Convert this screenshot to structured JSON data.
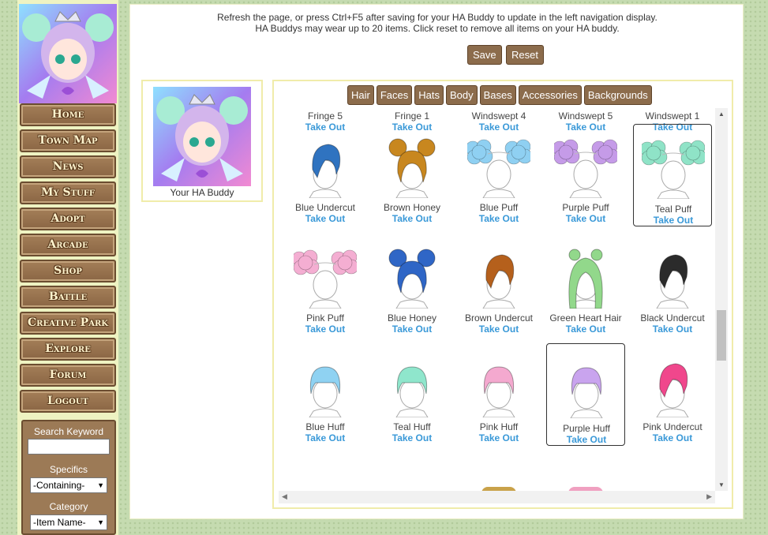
{
  "nav": [
    "Home",
    "Town Map",
    "News",
    "My Stuff",
    "Adopt",
    "Arcade",
    "Shop",
    "Battle",
    "Creative Park",
    "Explore",
    "Forum",
    "Logout"
  ],
  "search": {
    "keyword_label": "Search Keyword",
    "keyword_value": "",
    "specifics_label": "Specifics",
    "specifics_value": "-Containing-",
    "category_label": "Category",
    "category_value": "-Item Name-"
  },
  "info": {
    "line1": "Refresh the page, or press Ctrl+F5 after saving for your HA Buddy to update in the left navigation display.",
    "line2": "HA Buddys may wear up to 20 items. Click reset to remove all items on your HA buddy."
  },
  "actions": {
    "save": "Save",
    "reset": "Reset"
  },
  "buddy_label": "Your HA Buddy",
  "tabs": [
    "Hair",
    "Faces",
    "Hats",
    "Body",
    "Bases",
    "Accessories",
    "Backgrounds"
  ],
  "take_out_label": "Take Out",
  "items_top": [
    "Fringe 5",
    "Fringe 1",
    "Windswept 4",
    "Windswept 5",
    "Windswept 1"
  ],
  "items": [
    {
      "name": "Blue Undercut",
      "style": "undercut",
      "color": "#2f73c0",
      "selected": false
    },
    {
      "name": "Brown Honey",
      "style": "buns",
      "color": "#c8871f",
      "selected": false
    },
    {
      "name": "Blue Puff",
      "style": "puff",
      "color": "#8fd0f2",
      "selected": false
    },
    {
      "name": "Purple Puff",
      "style": "puff",
      "color": "#c59be8",
      "selected": false
    },
    {
      "name": "Teal Puff",
      "style": "puff",
      "color": "#8fe3c7",
      "selected": true
    },
    {
      "name": "Pink Puff",
      "style": "puff",
      "color": "#f4aed2",
      "selected": false
    },
    {
      "name": "Blue Honey",
      "style": "buns",
      "color": "#2f66c6",
      "selected": false
    },
    {
      "name": "Brown Undercut",
      "style": "undercut",
      "color": "#b5601c",
      "selected": false
    },
    {
      "name": "Green Heart Hair",
      "style": "long",
      "color": "#92d88b",
      "selected": false
    },
    {
      "name": "Black Undercut",
      "style": "undercut",
      "color": "#2b2b2b",
      "selected": false
    },
    {
      "name": "Blue Huff",
      "style": "bob",
      "color": "#8fd2f2",
      "selected": false
    },
    {
      "name": "Teal Huff",
      "style": "bob",
      "color": "#8fe6cc",
      "selected": false
    },
    {
      "name": "Pink Huff",
      "style": "bob",
      "color": "#f4a9cf",
      "selected": false
    },
    {
      "name": "Purple Huff",
      "style": "bob",
      "color": "#c9a4ee",
      "selected": true
    },
    {
      "name": "Pink Undercut",
      "style": "undercut",
      "color": "#f0478c",
      "selected": false
    }
  ],
  "colors": {
    "nav_bg": "#9a7652",
    "tab_bg": "#8c6c4c",
    "take_out": "#3a99d8",
    "panel_border": "#f0ecaa"
  }
}
